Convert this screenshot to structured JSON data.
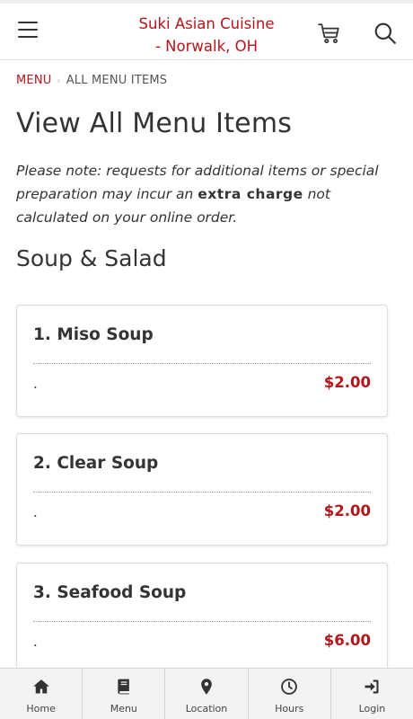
{
  "header": {
    "brand_line1": "Suki Asian Cuisine",
    "brand_line2": "- Norwalk, OH",
    "menu_icon": "hamburger-menu-icon",
    "cart_icon": "cart-icon",
    "search_icon": "search-icon"
  },
  "breadcrumb": {
    "link": "MENU",
    "current": "ALL MENU ITEMS"
  },
  "page": {
    "title": "View All Menu Items",
    "note_part1": "Please note: requests for additional items or special preparation may incur an ",
    "note_strong": "extra charge",
    "note_part2": " not calculated on your online order.",
    "section_title": "Soup & Salad"
  },
  "menu_items": [
    {
      "name": "1. Miso Soup",
      "description": ".",
      "price": "$2.00"
    },
    {
      "name": "2. Clear Soup",
      "description": ".",
      "price": "$2.00"
    },
    {
      "name": "3. Seafood Soup",
      "description": ".",
      "price": "$6.00"
    }
  ],
  "bottom_nav": [
    {
      "label": "Home",
      "icon": "home-icon"
    },
    {
      "label": "Menu",
      "icon": "book-icon"
    },
    {
      "label": "Location",
      "icon": "map-pin-icon"
    },
    {
      "label": "Hours",
      "icon": "clock-icon"
    },
    {
      "label": "Login",
      "icon": "sign-in-icon"
    }
  ],
  "colors": {
    "accent": "#b4161b",
    "text": "#333333",
    "nav_background": "#f3f3f3"
  }
}
